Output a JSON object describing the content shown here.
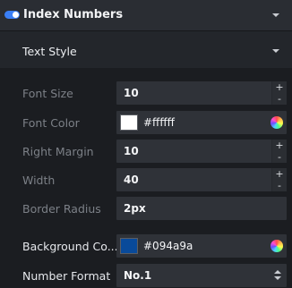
{
  "section": {
    "title": "Index Numbers",
    "enabled": true
  },
  "subsection": {
    "title": "Text Style"
  },
  "fields": {
    "font_size": {
      "label": "Font Size",
      "value": "10",
      "inc": "+",
      "dec": "-"
    },
    "font_color": {
      "label": "Font Color",
      "value": "#ffffff",
      "swatch": "#ffffff"
    },
    "right_margin": {
      "label": "Right Margin",
      "value": "10",
      "inc": "+",
      "dec": "-"
    },
    "width": {
      "label": "Width",
      "value": "40",
      "inc": "+",
      "dec": "-"
    },
    "border_radius": {
      "label": "Border Radius",
      "value": "2px"
    },
    "background_color": {
      "label": "Background Co...",
      "value": "#094a9a",
      "swatch": "#094a9a"
    },
    "number_format": {
      "label": "Number Format",
      "value": "No.1"
    }
  },
  "icons": {
    "toggle": "toggle-switch-icon",
    "collapse": "chevron-down-icon",
    "color_picker": "color-wheel-icon",
    "select": "sort-arrows-icon"
  },
  "colors": {
    "accent": "#3a7ff6",
    "panel": "#1b1d21",
    "field": "#2f3238"
  }
}
